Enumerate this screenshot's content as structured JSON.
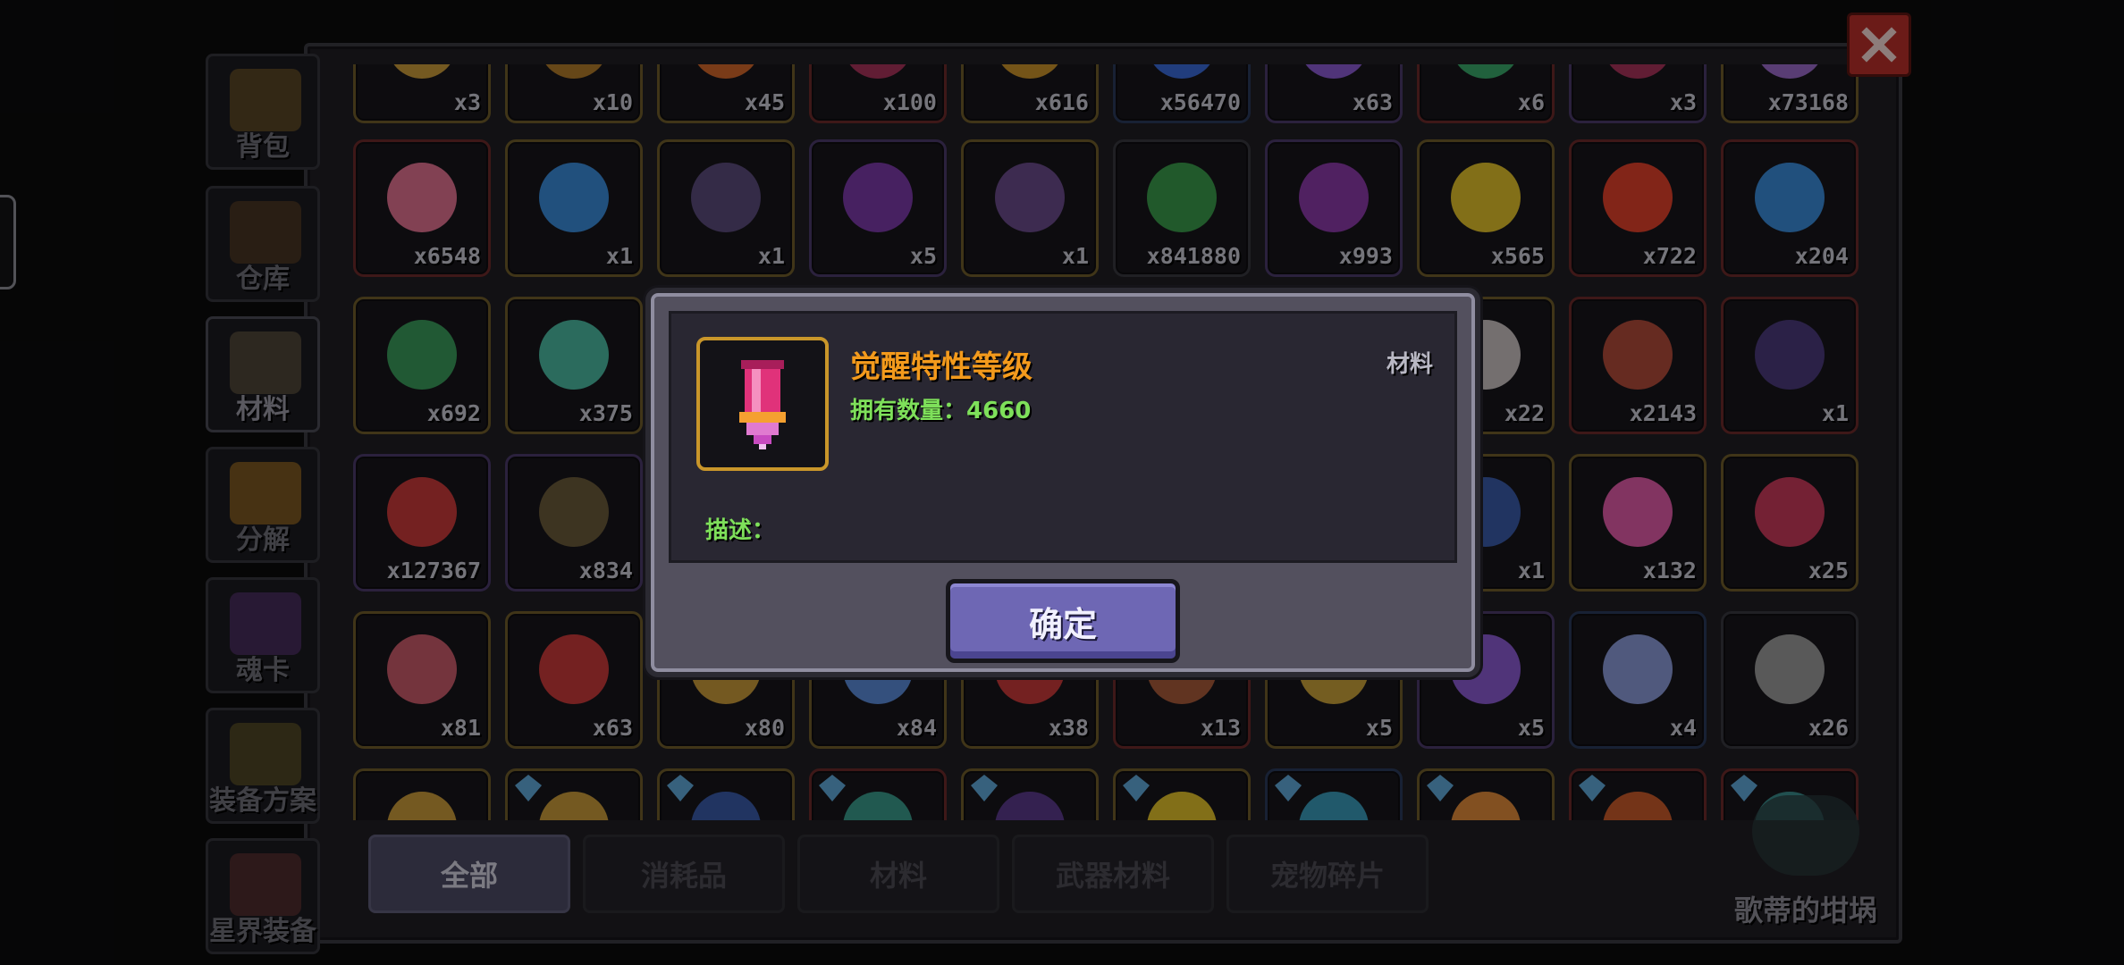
{
  "sidebar": {
    "items": [
      {
        "label": "背包",
        "icon": "backpack-chest-icon",
        "color": "#8a6a2a"
      },
      {
        "label": "仓库",
        "icon": "warehouse-chest-icon",
        "color": "#6e4a26"
      },
      {
        "label": "材料",
        "icon": "materials-box-icon",
        "color": "#7a6a4a",
        "active": true
      },
      {
        "label": "分解",
        "icon": "dismantle-icon",
        "color": "#c88a22"
      },
      {
        "label": "魂卡",
        "icon": "soul-card-icon",
        "color": "#6a3a8a"
      },
      {
        "label": "装备方案",
        "icon": "equipment-plan-icon",
        "color": "#7a6a2a"
      },
      {
        "label": "星界装备",
        "icon": "astral-equipment-icon",
        "color": "#7a3a3a"
      }
    ]
  },
  "grid": {
    "rows": [
      {
        "items": [
          {
            "qty": "x3",
            "frame": "gold",
            "color": "#c89a3a"
          },
          {
            "qty": "x10",
            "frame": "gold",
            "color": "#b07a2a"
          },
          {
            "qty": "x45",
            "frame": "gold",
            "color": "#d0662a"
          },
          {
            "qty": "x100",
            "frame": "red",
            "color": "#a8325a"
          },
          {
            "qty": "x616",
            "frame": "gold",
            "color": "#c8922a"
          },
          {
            "qty": "x56470",
            "frame": "blue",
            "color": "#3a6ad8"
          },
          {
            "qty": "x63",
            "frame": "purple",
            "color": "#8a5ad0"
          },
          {
            "qty": "x6",
            "frame": "red",
            "color": "#3aa86a"
          },
          {
            "qty": "x3",
            "frame": "purple",
            "color": "#a8325a"
          },
          {
            "qty": "x73168",
            "frame": "gold",
            "color": "#9a6ac8"
          }
        ]
      },
      {
        "items": [
          {
            "qty": "x6548",
            "frame": "red",
            "color": "#e07090"
          },
          {
            "qty": "x1",
            "frame": "gold",
            "color": "#3a8ad8"
          },
          {
            "qty": "x1",
            "frame": "gold",
            "color": "#5a4a7a"
          },
          {
            "qty": "x5",
            "frame": "purple",
            "color": "#7a3aa8"
          },
          {
            "qty": "x1",
            "frame": "gold",
            "color": "#6a4a8a"
          },
          {
            "qty": "x841880",
            "frame": "gray",
            "color": "#3a9a4a"
          },
          {
            "qty": "x993",
            "frame": "purple",
            "color": "#8a3aa8"
          },
          {
            "qty": "x565",
            "frame": "gold",
            "color": "#e0c02a"
          },
          {
            "qty": "x722",
            "frame": "red",
            "color": "#e0402a"
          },
          {
            "qty": "x204",
            "frame": "red",
            "color": "#3a8ad8"
          }
        ]
      },
      {
        "items": [
          {
            "qty": "x692",
            "frame": "gold",
            "color": "#3a9a5a"
          },
          {
            "qty": "x375",
            "frame": "gold",
            "color": "#4ab8a0"
          },
          {
            "qty": "",
            "frame": "gold",
            "color": "#444"
          },
          {
            "qty": "",
            "frame": "gold",
            "color": "#444"
          },
          {
            "qty": "",
            "frame": "gold",
            "color": "#444"
          },
          {
            "qty": "",
            "frame": "gold",
            "color": "#444"
          },
          {
            "qty": "",
            "frame": "gold",
            "color": "#444"
          },
          {
            "qty": "x22",
            "frame": "gold",
            "color": "#c8c0c0"
          },
          {
            "qty": "x2143",
            "frame": "red",
            "color": "#b04a3a"
          },
          {
            "qty": "x1",
            "frame": "red",
            "color": "#4a3a7a"
          }
        ]
      },
      {
        "items": [
          {
            "qty": "x127367",
            "frame": "purple",
            "color": "#c83a3a"
          },
          {
            "qty": "x834",
            "frame": "purple",
            "color": "#6a5a3a"
          },
          {
            "qty": "",
            "frame": "gold",
            "color": "#444"
          },
          {
            "qty": "",
            "frame": "gold",
            "color": "#444"
          },
          {
            "qty": "",
            "frame": "gold",
            "color": "#444"
          },
          {
            "qty": "",
            "frame": "gold",
            "color": "#444"
          },
          {
            "qty": "",
            "frame": "gold",
            "color": "#444"
          },
          {
            "qty": "x1",
            "frame": "gold",
            "color": "#3a5aa8"
          },
          {
            "qty": "x132",
            "frame": "gold",
            "color": "#e05aa8"
          },
          {
            "qty": "x25",
            "frame": "gold",
            "color": "#c83a5a"
          }
        ]
      },
      {
        "items": [
          {
            "qty": "x81",
            "frame": "gold",
            "color": "#c85a6a"
          },
          {
            "qty": "x63",
            "frame": "gold",
            "color": "#c83a3a"
          },
          {
            "qty": "x80",
            "frame": "gold",
            "color": "#c89a3a"
          },
          {
            "qty": "x84",
            "frame": "gold",
            "color": "#5a8ad8"
          },
          {
            "qty": "x38",
            "frame": "gold",
            "color": "#c83a3a"
          },
          {
            "qty": "x13",
            "frame": "red",
            "color": "#a85a3a"
          },
          {
            "qty": "x5",
            "frame": "gold",
            "color": "#c8a03a"
          },
          {
            "qty": "x5",
            "frame": "purple",
            "color": "#8a5ad0"
          },
          {
            "qty": "x4",
            "frame": "blue",
            "color": "#8a9ad8"
          },
          {
            "qty": "x26",
            "frame": "gray",
            "color": "#9a9a9a"
          }
        ]
      },
      {
        "items": [
          {
            "qty": "",
            "frame": "gold",
            "color": "#c89a3a"
          },
          {
            "qty": "",
            "frame": "gold",
            "color": "#c89a3a",
            "pet": true
          },
          {
            "qty": "",
            "frame": "gold",
            "color": "#3a5aa8",
            "pet": true
          },
          {
            "qty": "",
            "frame": "red",
            "color": "#3a9a8a",
            "pet": true
          },
          {
            "qty": "",
            "frame": "gold",
            "color": "#5a3a8a",
            "pet": true
          },
          {
            "qty": "",
            "frame": "gold",
            "color": "#e0c02a",
            "pet": true
          },
          {
            "qty": "",
            "frame": "blue",
            "color": "#3a9ab8",
            "pet": true
          },
          {
            "qty": "",
            "frame": "gold",
            "color": "#e08a3a",
            "pet": true
          },
          {
            "qty": "",
            "frame": "red",
            "color": "#c85a2a",
            "pet": true
          },
          {
            "qty": "",
            "frame": "red",
            "color": "#3a8a8a",
            "pet": true
          }
        ]
      }
    ]
  },
  "tabs": [
    {
      "label": "全部",
      "active": true
    },
    {
      "label": "消耗品"
    },
    {
      "label": "材料"
    },
    {
      "label": "武器材料"
    },
    {
      "label": "宠物碎片"
    }
  ],
  "pot": {
    "label": "歌蒂的坩埚",
    "icon": "cauldron-icon"
  },
  "close_button": {
    "icon": "close-icon"
  },
  "dialog": {
    "item_name": "觉醒特性等级",
    "category": "材料",
    "owned_label": "拥有数量：",
    "owned_count": "4660",
    "desc_label": "描述：",
    "confirm_label": "确定",
    "item_icon": "awakening-medal-icon",
    "colors": {
      "name": "#f39a1c",
      "green_text": "#7ee05a",
      "frame": "#c9962a",
      "button": "#6e67b4"
    }
  }
}
